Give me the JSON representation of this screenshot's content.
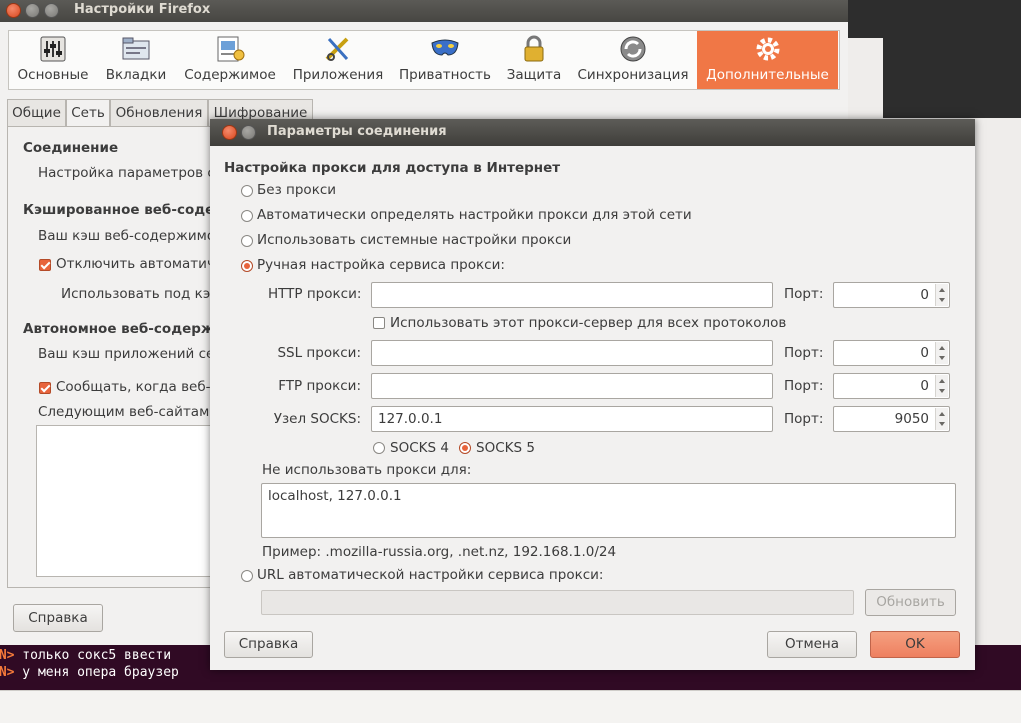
{
  "background_window": {
    "title": "Настройки Firefox",
    "toolbar": [
      {
        "label": "Основные",
        "icon": "sliders-icon"
      },
      {
        "label": "Вкладки",
        "icon": "tabs-icon"
      },
      {
        "label": "Содержимое",
        "icon": "content-icon"
      },
      {
        "label": "Приложения",
        "icon": "applications-icon"
      },
      {
        "label": "Приватность",
        "icon": "mask-icon"
      },
      {
        "label": "Защита",
        "icon": "lock-icon"
      },
      {
        "label": "Синхронизация",
        "icon": "sync-icon"
      },
      {
        "label": "Дополнительные",
        "icon": "gear-icon"
      }
    ],
    "tabs": [
      "Общие",
      "Сеть",
      "Обновления",
      "Шифрование"
    ],
    "sections": {
      "connection_head": "Соединение",
      "connection_text": "Настройка параметров с",
      "cache_head": "Кэшированное веб-содер",
      "cache_text": "Ваш кэш веб-содержимо",
      "cache_check": "Отключить автоматич",
      "cache_use": "Использовать под кэ",
      "offline_head": "Автономное веб-содерж",
      "offline_text": "Ваш кэш приложений се",
      "offline_check": "Сообщать, когда веб-с",
      "offline_sites": "Следующим веб-сайтам"
    },
    "help_button": "Справка"
  },
  "terminal": {
    "lines": [
      {
        "prompt": "LN>",
        "text": " только сокс5 ввести"
      },
      {
        "prompt": "LN>",
        "text": " у меня опера браузер"
      }
    ]
  },
  "dialog": {
    "title": "Параметры соединения",
    "heading": "Настройка прокси для доступа в Интернет",
    "options": {
      "no_proxy": "Без прокси",
      "auto_detect": "Автоматически определять настройки прокси для этой сети",
      "system": "Использовать системные настройки прокси",
      "manual": "Ручная настройка сервиса прокси:",
      "auto_url": "URL автоматической настройки сервиса прокси:"
    },
    "selected_option": "manual",
    "port_label": "Порт:",
    "http": {
      "label": "HTTP прокси:",
      "value": "",
      "port": "0"
    },
    "use_for_all": "Использовать этот прокси-сервер для всех протоколов",
    "ssl": {
      "label": "SSL прокси:",
      "value": "",
      "port": "0"
    },
    "ftp": {
      "label": "FTP прокси:",
      "value": "",
      "port": "0"
    },
    "socks": {
      "label": "Узел SOCKS:",
      "value": "127.0.0.1",
      "port": "9050"
    },
    "socks4": "SOCKS 4",
    "socks5": "SOCKS 5",
    "socks_selected": "socks5",
    "no_proxy_for_label": "Не использовать прокси для:",
    "no_proxy_for_value": "localhost, 127.0.0.1",
    "example": "Пример: .mozilla-russia.org, .net.nz, 192.168.1.0/24",
    "auto_url_value": "",
    "reload_button": "Обновить",
    "help_button": "Справка",
    "cancel_button": "Отмена",
    "ok_button": "OK"
  },
  "colors": {
    "accent": "#f07746",
    "ok_button": "#ee8060",
    "terminal_bg": "#300a24"
  }
}
